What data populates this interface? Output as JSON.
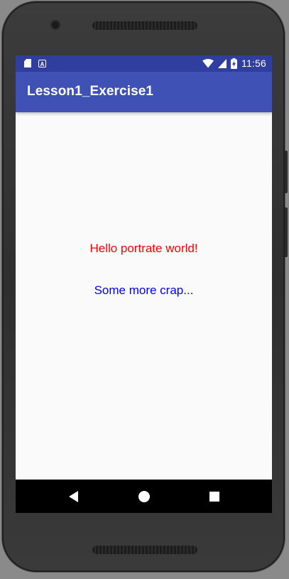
{
  "status_bar": {
    "time": "11:56",
    "icons_left": [
      "sd-card-icon",
      "autofill-icon"
    ],
    "icons_right": [
      "wifi-icon",
      "cell-signal-icon",
      "battery-charging-icon"
    ],
    "a_glyph": "A"
  },
  "app_bar": {
    "title": "Lesson1_Exercise1"
  },
  "content": {
    "line1": "Hello portrate world!",
    "line2": "Some more crap..."
  },
  "nav_bar": {
    "buttons": [
      "back-icon",
      "home-icon",
      "recents-icon"
    ]
  },
  "colors": {
    "status_bar": "#303f9f",
    "app_bar": "#3f51b5",
    "line1": "#ff0000",
    "line2": "#0000ff",
    "background": "#fafafa"
  }
}
